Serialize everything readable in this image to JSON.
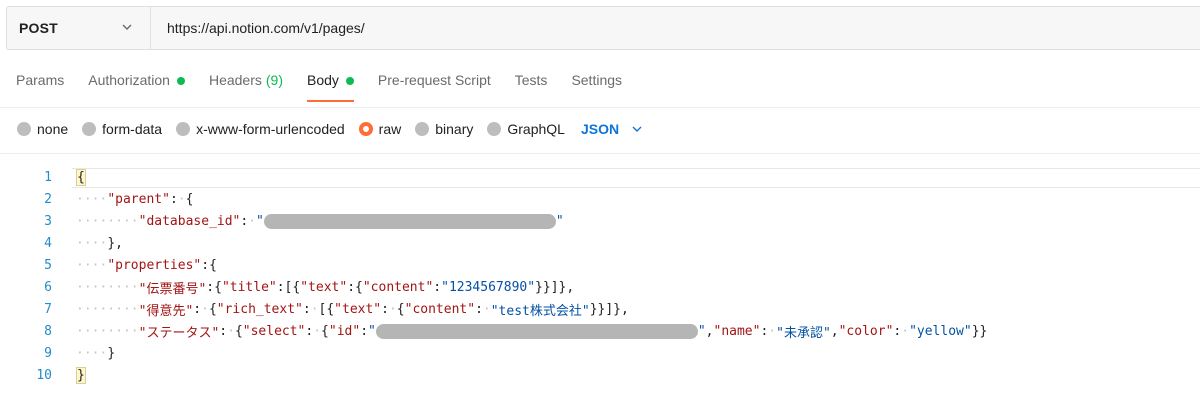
{
  "request": {
    "method": "POST",
    "url": "https://api.notion.com/v1/pages/"
  },
  "tabs": [
    {
      "label": "Params",
      "active": false
    },
    {
      "label": "Authorization",
      "active": false,
      "status": "green-dot"
    },
    {
      "label": "Headers",
      "count": "(9)",
      "active": false
    },
    {
      "label": "Body",
      "active": true,
      "status": "green-dot"
    },
    {
      "label": "Pre-request Script",
      "active": false
    },
    {
      "label": "Tests",
      "active": false
    },
    {
      "label": "Settings",
      "active": false
    }
  ],
  "body_types": [
    {
      "label": "none",
      "selected": false
    },
    {
      "label": "form-data",
      "selected": false
    },
    {
      "label": "x-www-form-urlencoded",
      "selected": false
    },
    {
      "label": "raw",
      "selected": true
    },
    {
      "label": "binary",
      "selected": false
    },
    {
      "label": "GraphQL",
      "selected": false
    }
  ],
  "raw_format": "JSON",
  "editor": {
    "line_numbers": [
      "1",
      "2",
      "3",
      "4",
      "5",
      "6",
      "7",
      "8",
      "9",
      "10"
    ],
    "tokens": {
      "open_brace": "{",
      "close_brace": "}",
      "parent_key": "\"parent\"",
      "database_id_key": "\"database_id\"",
      "properties_key": "\"properties\"",
      "line6_key": "\"伝票番号\"",
      "title_key": "\"title\"",
      "text_key": "\"text\"",
      "content_key": "\"content\"",
      "line6_value": "\"1234567890\"",
      "line7_key": "\"得意先\"",
      "rich_text_key": "\"rich_text\"",
      "line7_value": "\"test株式会社\"",
      "line8_key": "\"ステータス\"",
      "select_key": "\"select\"",
      "id_key": "\"id\"",
      "name_key": "\"name\"",
      "name_value": "\"未承認\"",
      "color_key": "\"color\"",
      "color_value": "\"yellow\""
    }
  },
  "colors": {
    "accent": "#ff6c37",
    "status_green": "#0cbb52",
    "link_blue": "#0e75d8",
    "json_key": "#a31515",
    "json_string": "#0451a5"
  }
}
